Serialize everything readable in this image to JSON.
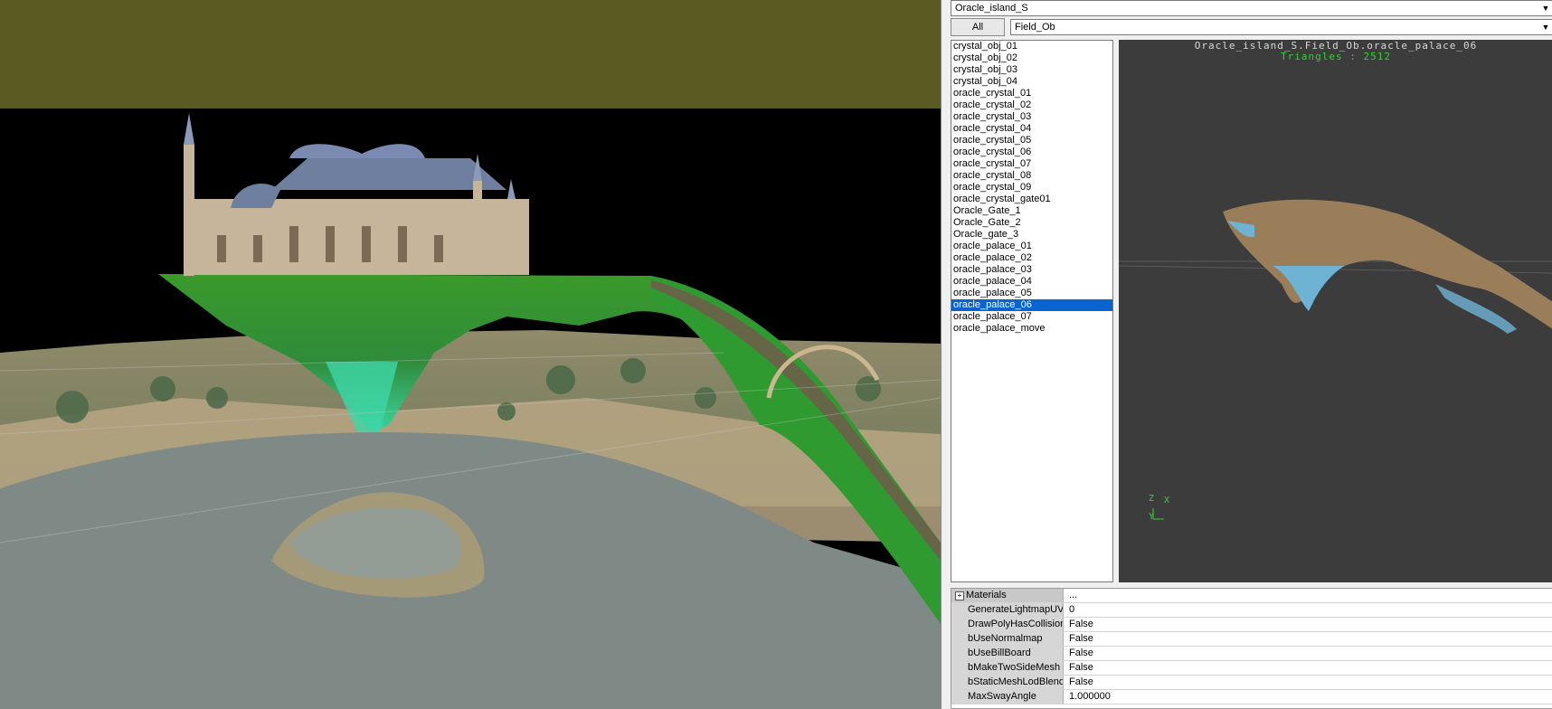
{
  "map_selector": {
    "value": "Oracle_island_S"
  },
  "all_button": {
    "label": "All"
  },
  "category_selector": {
    "value": "Field_Ob"
  },
  "object_list": {
    "items": [
      "crystal_obj_01",
      "crystal_obj_02",
      "crystal_obj_03",
      "crystal_obj_04",
      "oracle_crystal_01",
      "oracle_crystal_02",
      "oracle_crystal_03",
      "oracle_crystal_04",
      "oracle_crystal_05",
      "oracle_crystal_06",
      "oracle_crystal_07",
      "oracle_crystal_08",
      "oracle_crystal_09",
      "oracle_crystal_gate01",
      "Oracle_Gate_1",
      "Oracle_Gate_2",
      "Oracle_gate_3",
      "oracle_palace_01",
      "oracle_palace_02",
      "oracle_palace_03",
      "oracle_palace_04",
      "oracle_palace_05",
      "oracle_palace_06",
      "oracle_palace_07",
      "oracle_palace_move"
    ],
    "selected": "oracle_palace_06"
  },
  "preview": {
    "title": "Oracle_island_S.Field_Ob.oracle_palace_06",
    "triangles": "Triangles : 2512",
    "axis_z": "Z",
    "axis_x": "X",
    "axis_y": "Y"
  },
  "properties": {
    "category": "Materials",
    "category_value": "...",
    "expander": "+",
    "rows": [
      {
        "name": "GenerateLightmapUV...",
        "value": "0"
      },
      {
        "name": "DrawPolyHasCollision...",
        "value": "False"
      },
      {
        "name": "bUseNormalmap",
        "value": "False"
      },
      {
        "name": "bUseBillBoard",
        "value": "False"
      },
      {
        "name": "bMakeTwoSideMesh",
        "value": "False"
      },
      {
        "name": "bStaticMeshLodBlend",
        "value": "False"
      },
      {
        "name": "MaxSwayAngle",
        "value": "1.000000"
      }
    ]
  },
  "colors": {
    "sky_band": "#5a5b23",
    "selection": "#0a64d0",
    "triangles_text": "#2fd32f",
    "preview_bg": "#3c3c3c"
  }
}
